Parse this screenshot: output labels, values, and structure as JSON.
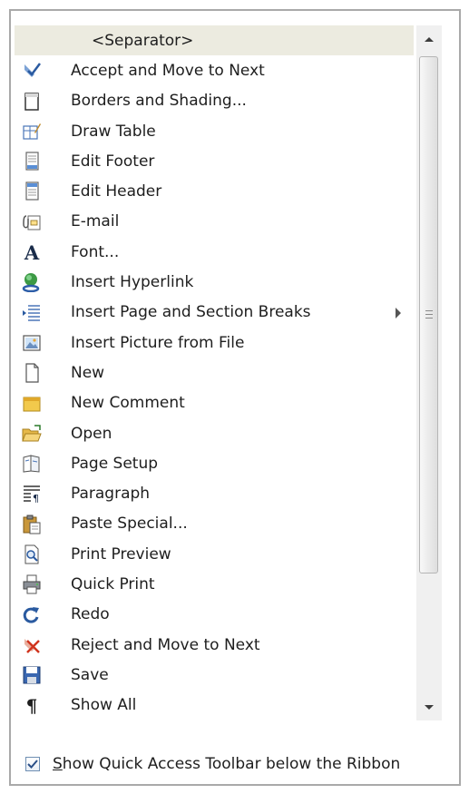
{
  "list": {
    "items": [
      {
        "label": "<Separator>",
        "icon": "none",
        "selected": true
      },
      {
        "label": "Accept and Move to Next",
        "icon": "accept-icon"
      },
      {
        "label": "Borders and Shading...",
        "icon": "borders-icon"
      },
      {
        "label": "Draw Table",
        "icon": "draw-table-icon"
      },
      {
        "label": "Edit Footer",
        "icon": "footer-icon"
      },
      {
        "label": "Edit Header",
        "icon": "header-icon"
      },
      {
        "label": "E-mail",
        "icon": "email-icon"
      },
      {
        "label": "Font...",
        "icon": "font-icon"
      },
      {
        "label": "Insert Hyperlink",
        "icon": "hyperlink-icon"
      },
      {
        "label": "Insert Page and Section Breaks",
        "icon": "page-breaks-icon",
        "submenu": true
      },
      {
        "label": "Insert Picture from File",
        "icon": "picture-icon"
      },
      {
        "label": "New",
        "icon": "new-icon"
      },
      {
        "label": "New Comment",
        "icon": "comment-icon"
      },
      {
        "label": "Open",
        "icon": "open-folder-icon"
      },
      {
        "label": "Page Setup",
        "icon": "page-setup-icon"
      },
      {
        "label": "Paragraph",
        "icon": "paragraph-icon"
      },
      {
        "label": "Paste Special...",
        "icon": "paste-icon"
      },
      {
        "label": "Print Preview",
        "icon": "print-preview-icon"
      },
      {
        "label": "Quick Print",
        "icon": "printer-icon"
      },
      {
        "label": "Redo",
        "icon": "redo-icon"
      },
      {
        "label": "Reject and Move to Next",
        "icon": "reject-icon"
      },
      {
        "label": "Save",
        "icon": "save-icon"
      },
      {
        "label": "Show All",
        "icon": "pilcrow-icon"
      }
    ]
  },
  "footer": {
    "checkbox_checked": true,
    "label_s": "S",
    "label_rest": "how Quick Access Toolbar below the Ribbon"
  }
}
